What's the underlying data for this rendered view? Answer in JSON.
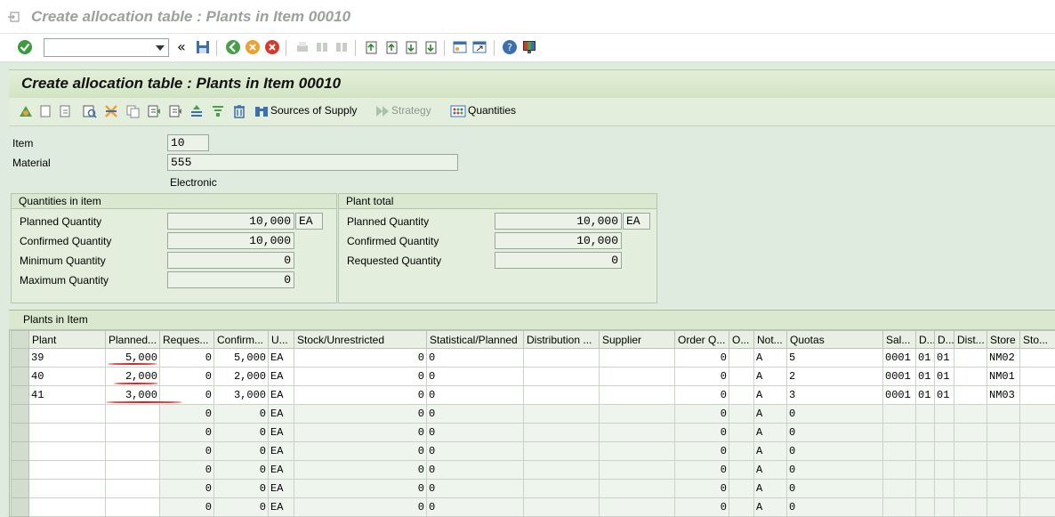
{
  "window": {
    "title": "Create allocation table : Plants in Item 00010"
  },
  "screen": {
    "title": "Create allocation table : Plants in Item 00010"
  },
  "command_field": {
    "value": ""
  },
  "app_toolbar": {
    "sources_of_supply": "Sources of Supply",
    "strategy": "Strategy",
    "quantities": "Quantities"
  },
  "header": {
    "item_label": "Item",
    "item_value": "10",
    "material_label": "Material",
    "material_value": "555",
    "material_desc": "Electronic"
  },
  "quantities_in_item": {
    "title": "Quantities in item",
    "planned_label": "Planned Quantity",
    "planned_value": "10,000",
    "unit": "EA",
    "confirmed_label": "Confirmed Quantity",
    "confirmed_value": "10,000",
    "minimum_label": "Minimum Quantity",
    "minimum_value": "0",
    "maximum_label": "Maximum Quantity",
    "maximum_value": "0"
  },
  "plant_total": {
    "title": "Plant total",
    "planned_label": "Planned Quantity",
    "planned_value": "10,000",
    "unit": "EA",
    "confirmed_label": "Confirmed Quantity",
    "confirmed_value": "10,000",
    "requested_label": "Requested Quantity",
    "requested_value": "0"
  },
  "plants_table": {
    "title": "Plants in Item",
    "columns": [
      "Plant",
      "Planned...",
      "Reques...",
      "Confirm...",
      "U...",
      "Stock/Unrestricted",
      "Statistical/Planned",
      "Distribution ...",
      "Supplier",
      "Order Q...",
      "O...",
      "Not...",
      "Quotas",
      "Sal...",
      "D...",
      "D...",
      "Dist...",
      "Store",
      "Sto..."
    ],
    "rows": [
      {
        "plant": "39",
        "planned": "5,000",
        "requested": "0",
        "confirmed": "5,000",
        "unit": "EA",
        "stock": "0",
        "statistical": "0",
        "distribution": "",
        "supplier": "",
        "order_qty": "0",
        "o": "",
        "not": "A",
        "quotas": "5",
        "sales": "0001",
        "d1": "01",
        "d2": "01",
        "dist": "",
        "store": "NM02",
        "sto": ""
      },
      {
        "plant": "40",
        "planned": "2,000",
        "requested": "0",
        "confirmed": "2,000",
        "unit": "EA",
        "stock": "0",
        "statistical": "0",
        "distribution": "",
        "supplier": "",
        "order_qty": "0",
        "o": "",
        "not": "A",
        "quotas": "2",
        "sales": "0001",
        "d1": "01",
        "d2": "01",
        "dist": "",
        "store": "NM01",
        "sto": ""
      },
      {
        "plant": "41",
        "planned": "3,000",
        "requested": "0",
        "confirmed": "3,000",
        "unit": "EA",
        "stock": "0",
        "statistical": "0",
        "distribution": "",
        "supplier": "",
        "order_qty": "0",
        "o": "",
        "not": "A",
        "quotas": "3",
        "sales": "0001",
        "d1": "01",
        "d2": "01",
        "dist": "",
        "store": "NM03",
        "sto": ""
      },
      {
        "plant": "",
        "planned": "",
        "requested": "0",
        "confirmed": "0",
        "unit": "EA",
        "stock": "0",
        "statistical": "0",
        "distribution": "",
        "supplier": "",
        "order_qty": "0",
        "o": "",
        "not": "A",
        "quotas": "0",
        "sales": "",
        "d1": "",
        "d2": "",
        "dist": "",
        "store": "",
        "sto": ""
      },
      {
        "plant": "",
        "planned": "",
        "requested": "0",
        "confirmed": "0",
        "unit": "EA",
        "stock": "0",
        "statistical": "0",
        "distribution": "",
        "supplier": "",
        "order_qty": "0",
        "o": "",
        "not": "A",
        "quotas": "0",
        "sales": "",
        "d1": "",
        "d2": "",
        "dist": "",
        "store": "",
        "sto": ""
      },
      {
        "plant": "",
        "planned": "",
        "requested": "0",
        "confirmed": "0",
        "unit": "EA",
        "stock": "0",
        "statistical": "0",
        "distribution": "",
        "supplier": "",
        "order_qty": "0",
        "o": "",
        "not": "A",
        "quotas": "0",
        "sales": "",
        "d1": "",
        "d2": "",
        "dist": "",
        "store": "",
        "sto": ""
      },
      {
        "plant": "",
        "planned": "",
        "requested": "0",
        "confirmed": "0",
        "unit": "EA",
        "stock": "0",
        "statistical": "0",
        "distribution": "",
        "supplier": "",
        "order_qty": "0",
        "o": "",
        "not": "A",
        "quotas": "0",
        "sales": "",
        "d1": "",
        "d2": "",
        "dist": "",
        "store": "",
        "sto": ""
      },
      {
        "plant": "",
        "planned": "",
        "requested": "0",
        "confirmed": "0",
        "unit": "EA",
        "stock": "0",
        "statistical": "0",
        "distribution": "",
        "supplier": "",
        "order_qty": "0",
        "o": "",
        "not": "A",
        "quotas": "0",
        "sales": "",
        "d1": "",
        "d2": "",
        "dist": "",
        "store": "",
        "sto": ""
      },
      {
        "plant": "",
        "planned": "",
        "requested": "0",
        "confirmed": "0",
        "unit": "EA",
        "stock": "0",
        "statistical": "0",
        "distribution": "",
        "supplier": "",
        "order_qty": "0",
        "o": "",
        "not": "A",
        "quotas": "0",
        "sales": "",
        "d1": "",
        "d2": "",
        "dist": "",
        "store": "",
        "sto": ""
      }
    ]
  },
  "colors": {
    "accent_green": "#dfebdf",
    "annotation_red": "#e02020"
  }
}
